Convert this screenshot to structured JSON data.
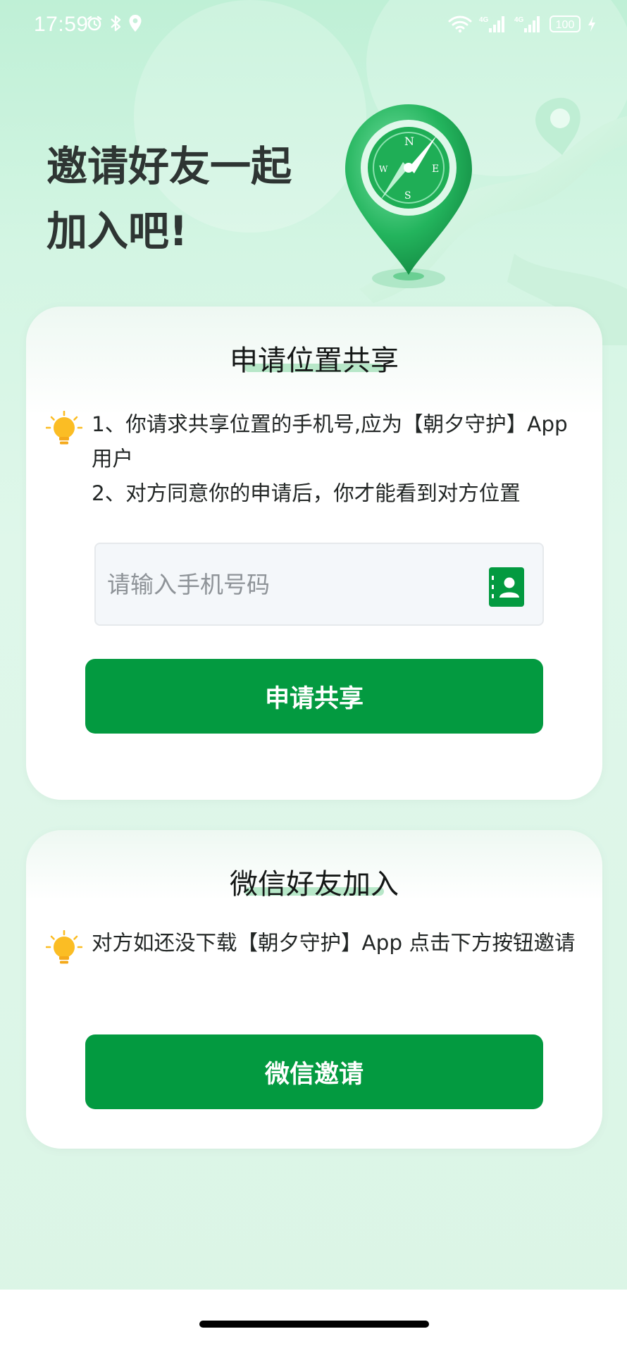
{
  "status_bar": {
    "time": "17:59",
    "battery": "100",
    "icons": [
      "alarm-icon",
      "bluetooth-icon",
      "location-icon",
      "wifi-icon",
      "signal-4g-icon",
      "signal-4g-icon",
      "battery-icon",
      "charging-icon"
    ],
    "network_label": "4G"
  },
  "header": {
    "title": "邀请好友一起\n加入吧!",
    "hero_icon": "compass-location-pin-icon",
    "compass_n": "N",
    "compass_e": "E",
    "compass_s": "S",
    "compass_w": "W"
  },
  "share_card": {
    "title": "申请位置共享",
    "tip_icon": "lightbulb-icon",
    "tip_line1": "1、你请求共享位置的手机号,应为【朝夕守护】App用户",
    "tip_line2": "2、对方同意你的申请后，你才能看到对方位置",
    "phone_input": {
      "value": "",
      "placeholder": "请输入手机号码"
    },
    "contacts_icon": "contacts-book-icon",
    "submit_label": "申请共享"
  },
  "wechat_card": {
    "title": "微信好友加入",
    "tip_icon": "lightbulb-icon",
    "tip_text": "对方如还没下载【朝夕守护】App 点击下方按钮邀请",
    "invite_label": "微信邀请"
  },
  "colors": {
    "primary": "#039a40",
    "background": "#dbf5e6",
    "title_underline": "#b7e7c8",
    "tip_bulb": "#fbbd24"
  }
}
